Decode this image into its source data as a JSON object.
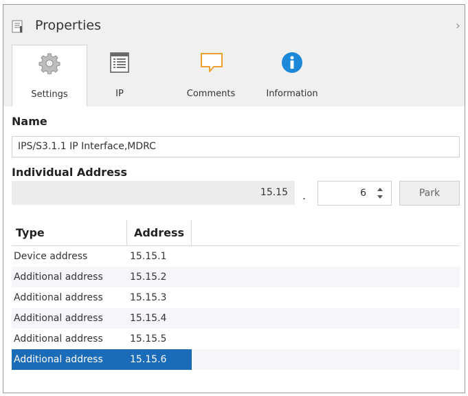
{
  "panel": {
    "title": "Properties",
    "title_icon": "properties-icon",
    "collapse_icon": "chevron-right-icon",
    "collapse_glyph": "›"
  },
  "tabs": [
    {
      "label": "Settings",
      "icon": "gear-icon",
      "active": true
    },
    {
      "label": "IP",
      "icon": "list-window-icon",
      "active": false
    },
    {
      "label": "Comments",
      "icon": "comment-icon",
      "active": false
    },
    {
      "label": "Information",
      "icon": "info-icon",
      "active": false
    }
  ],
  "name_section": {
    "label": "Name",
    "value": "IPS/S3.1.1 IP Interface,MDRC"
  },
  "address_section": {
    "label": "Individual Address",
    "prefix": "15.15",
    "separator": ".",
    "device_value": "6",
    "park_label": "Park"
  },
  "table": {
    "columns": [
      "Type",
      "Address"
    ],
    "rows": [
      {
        "type": "Device address",
        "address": "15.15.1"
      },
      {
        "type": "Additional address",
        "address": "15.15.2"
      },
      {
        "type": "Additional address",
        "address": "15.15.3"
      },
      {
        "type": "Additional address",
        "address": "15.15.4"
      },
      {
        "type": "Additional address",
        "address": "15.15.5"
      },
      {
        "type": "Additional address",
        "address": "15.15.6",
        "selected": true
      }
    ]
  },
  "colors": {
    "selection": "#1a6bb8",
    "info_icon": "#1e88d8",
    "comment_icon": "#f0a030"
  }
}
